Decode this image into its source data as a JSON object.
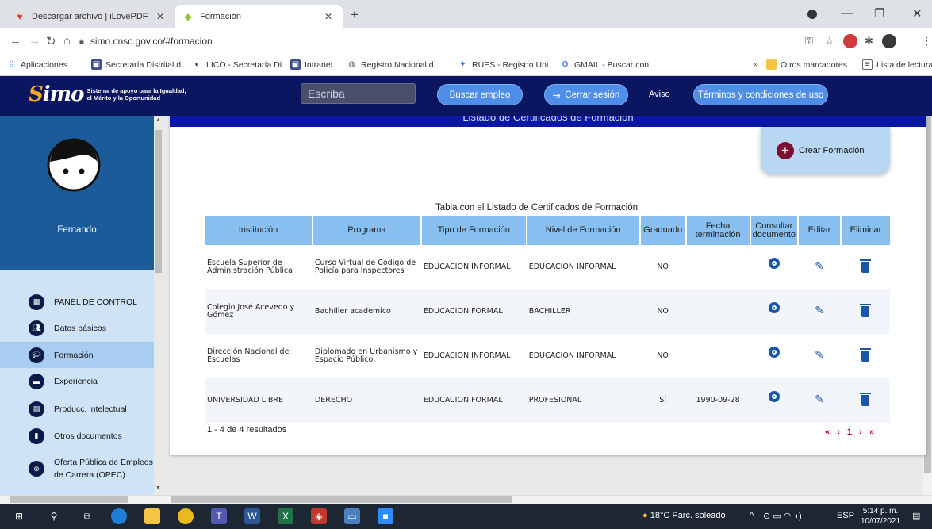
{
  "browser": {
    "tabs": [
      {
        "label": "Descargar archivo | iLovePDF",
        "active": false
      },
      {
        "label": "Formación",
        "active": true
      }
    ],
    "url": "simo.cnsc.gov.co/#formacion",
    "bookmarks": [
      "Aplicaciones",
      "Secretaría Distrital d...",
      "LICO - Secretaría Di...",
      "Intranet",
      "Registro Nacional d...",
      "RUES - Registro Uni...",
      "GMAIL - Buscar con..."
    ],
    "bookmarks_more": "»",
    "other_bookmarks": "Otros marcadores",
    "reading_list": "Lista de lectura"
  },
  "header": {
    "logo_text": "Sistema de apoyo para la Igualdad, el Mérito y la Oportunidad",
    "search_placeholder": "Escriba",
    "buscar_empleo": "Buscar empleo",
    "cerrar_sesion": "Cerrar sesión",
    "aviso": "Aviso",
    "terminos": "Términos y condiciones de uso"
  },
  "sidebar": {
    "user_name": "Fernando",
    "items": [
      {
        "label": "PANEL DE CONTROL",
        "icon": "dashboard-icon"
      },
      {
        "label": "Datos básicos",
        "icon": "people-icon"
      },
      {
        "label": "Formación",
        "icon": "graduation-icon",
        "active": true
      },
      {
        "label": "Experiencia",
        "icon": "briefcase-icon"
      },
      {
        "label": "Producc. intelectual",
        "icon": "book-icon"
      },
      {
        "label": "Otros documentos",
        "icon": "document-icon"
      },
      {
        "label": "Oferta Pública de Empleos de Carrera (OPEC)",
        "icon": "opec-icon"
      }
    ]
  },
  "main": {
    "section_title": "Listado de Certificados de Formación",
    "crear_formacion": "Crear Formación",
    "table_caption": "Tabla con el Listado de Certificados de Formación",
    "columns": [
      "Institución",
      "Programa",
      "Tipo de Formación",
      "Nivel de Formación",
      "Graduado",
      "Fecha terminación",
      "Consultar documento",
      "Editar",
      "Eliminar"
    ],
    "rows": [
      {
        "institucion": "Escuela Superior de Administración Pública",
        "programa": "Curso Virtual de Código de Policía para Inspectores",
        "tipo": "EDUCACION INFORMAL",
        "nivel": "EDUCACION INFORMAL",
        "graduado": "NO",
        "fecha": ""
      },
      {
        "institucion": "Colegio José Acevedo y Gómez",
        "programa": "Bachiller academico",
        "tipo": "EDUCACION FORMAL",
        "nivel": "BACHILLER",
        "graduado": "NO",
        "fecha": ""
      },
      {
        "institucion": "Dirección Nacional de Escuelas",
        "programa": "Diplomado en Urbanismo y Espacio Público",
        "tipo": "EDUCACION INFORMAL",
        "nivel": "EDUCACION INFORMAL",
        "graduado": "NO",
        "fecha": ""
      },
      {
        "institucion": "UNIVERSIDAD LIBRE",
        "programa": "DERECHO",
        "tipo": "EDUCACION FORMAL",
        "nivel": "PROFESIONAL",
        "graduado": "SÍ",
        "fecha": "1990-09-28"
      }
    ],
    "results_text": "1 - 4 de 4 resultados",
    "pager": {
      "first": "«",
      "prev": "‹",
      "page": "1",
      "next": "›",
      "last": "»"
    }
  },
  "taskbar": {
    "weather": "18°C Parc. soleado",
    "lang": "ESP",
    "time": "5:14 p. m.",
    "date": "10/07/2021"
  },
  "colors": {
    "header_bg": "#0b1660",
    "sidebar_bg": "#cfe3f7",
    "table_header_bg": "#86bff0",
    "action_icon": "#1a56a8",
    "pager": "#c0001a"
  }
}
